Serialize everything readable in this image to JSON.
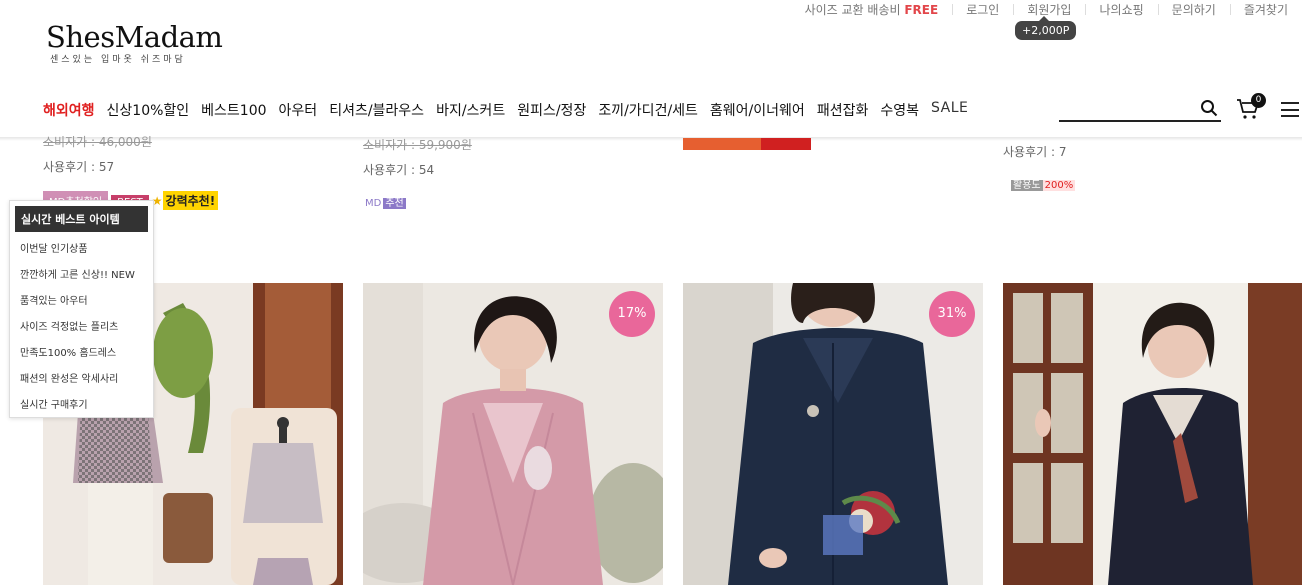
{
  "topbar": {
    "shipping_text": "사이즈 교환 배송비 ",
    "shipping_free": "FREE",
    "login": "로그인",
    "join": "회원가입",
    "join_point": "+2,000P",
    "myshop": "나의쇼핑",
    "inquiry": "문의하기",
    "bookmark": "즐겨찾기"
  },
  "logo": {
    "name": "ShesMadam",
    "tagline": "센스있는 입마옷 쉬즈마담"
  },
  "nav": {
    "items": [
      "해외여행",
      "신상10%할인",
      "베스트100",
      "아우터",
      "티셔츠/블라우스",
      "바지/스커트",
      "원피스/정장",
      "조끼/가디건/세트",
      "홈웨어/이너웨어",
      "패션잡화",
      "수영복",
      "SALE"
    ]
  },
  "search": {
    "placeholder": ""
  },
  "cart": {
    "count": "0"
  },
  "products_top": [
    {
      "price_label": "소비자가 : 46,000원",
      "reviews": "사용후기 : 57",
      "badge_md": "MD추천할인",
      "badge_best": "BEST",
      "badge_strong": "강력추천!"
    },
    {
      "price_label": "소비자가 : 59,900원",
      "reviews": "사용후기 : 54",
      "md_tag_prefix": "MD",
      "md_tag_word": "추천"
    },
    {},
    {
      "reviews": "사용후기 : 7",
      "use_label": "활용도",
      "use_value": "200%"
    }
  ],
  "floating_menu": {
    "title": "실시간 베스트 아이템",
    "links": [
      "이번달 인기상품",
      "깐깐하게 고른 신상!! NEW",
      "품격있는 아우터",
      "사이즈 걱정없는 플리츠",
      "만족도100% 홈드레스",
      "패션의 완성은 악세사리",
      "실시간 구매후기"
    ]
  },
  "products": [
    {
      "discount": ""
    },
    {
      "discount": "17%"
    },
    {
      "discount": "31%"
    },
    {
      "discount": ""
    }
  ],
  "colors": {
    "accent": "#e02020",
    "discount_badge": "#e9679a"
  }
}
